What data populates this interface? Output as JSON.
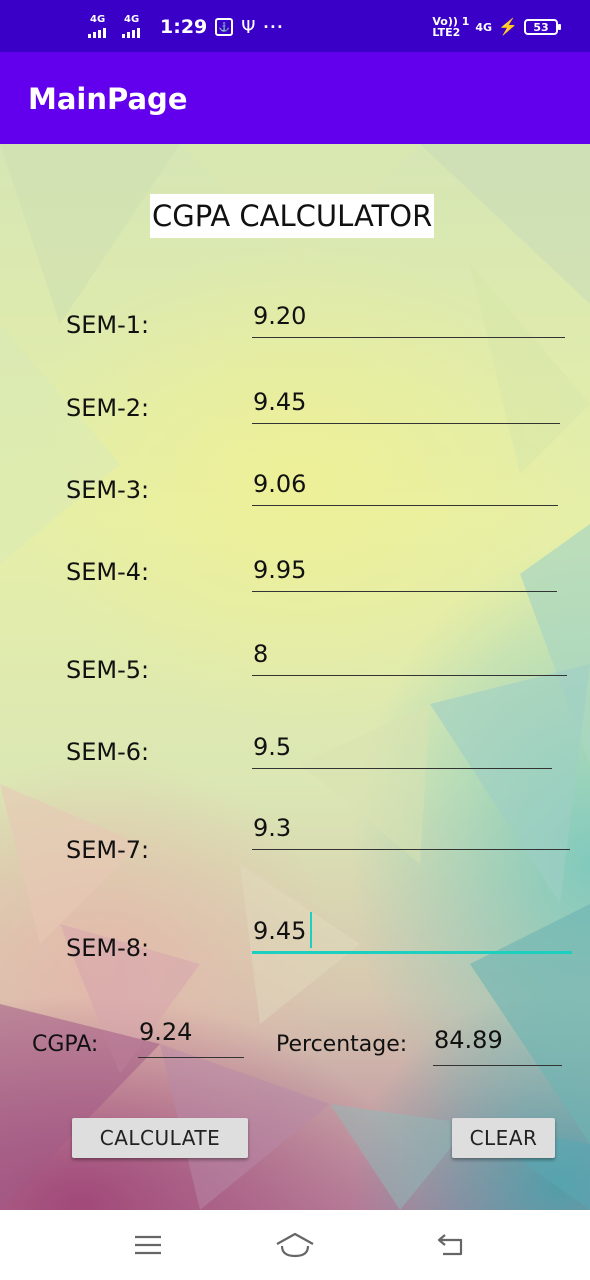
{
  "status_bar": {
    "network_1": "4G",
    "network_2": "4G",
    "time": "1:29",
    "volte_line1": "Vo)) 1",
    "volte_line2": "LTE2",
    "network_right": "4G",
    "battery": "53"
  },
  "app_bar": {
    "title": "MainPage"
  },
  "calculator": {
    "title": "CGPA CALCULATOR",
    "semesters": [
      {
        "label": "SEM-1:",
        "value": "9.20"
      },
      {
        "label": "SEM-2:",
        "value": "9.45"
      },
      {
        "label": "SEM-3:",
        "value": "9.06"
      },
      {
        "label": "SEM-4:",
        "value": "9.95"
      },
      {
        "label": "SEM-5:",
        "value": "8"
      },
      {
        "label": "SEM-6:",
        "value": "9.5"
      },
      {
        "label": "SEM-7:",
        "value": "9.3"
      },
      {
        "label": "SEM-8:",
        "value": "9.45"
      }
    ],
    "cgpa_label": "CGPA:",
    "cgpa_value": "9.24",
    "percentage_label": "Percentage:",
    "percentage_value": "84.89",
    "calculate_button": "CALCULATE",
    "clear_button": "CLEAR"
  },
  "colors": {
    "status_bar": "#3a00c8",
    "app_bar": "#6200ee",
    "focus_accent": "#1ccfbf"
  },
  "nav_bar": {
    "menu_icon": "menu-icon",
    "home_icon": "home-icon",
    "back_icon": "back-icon"
  }
}
